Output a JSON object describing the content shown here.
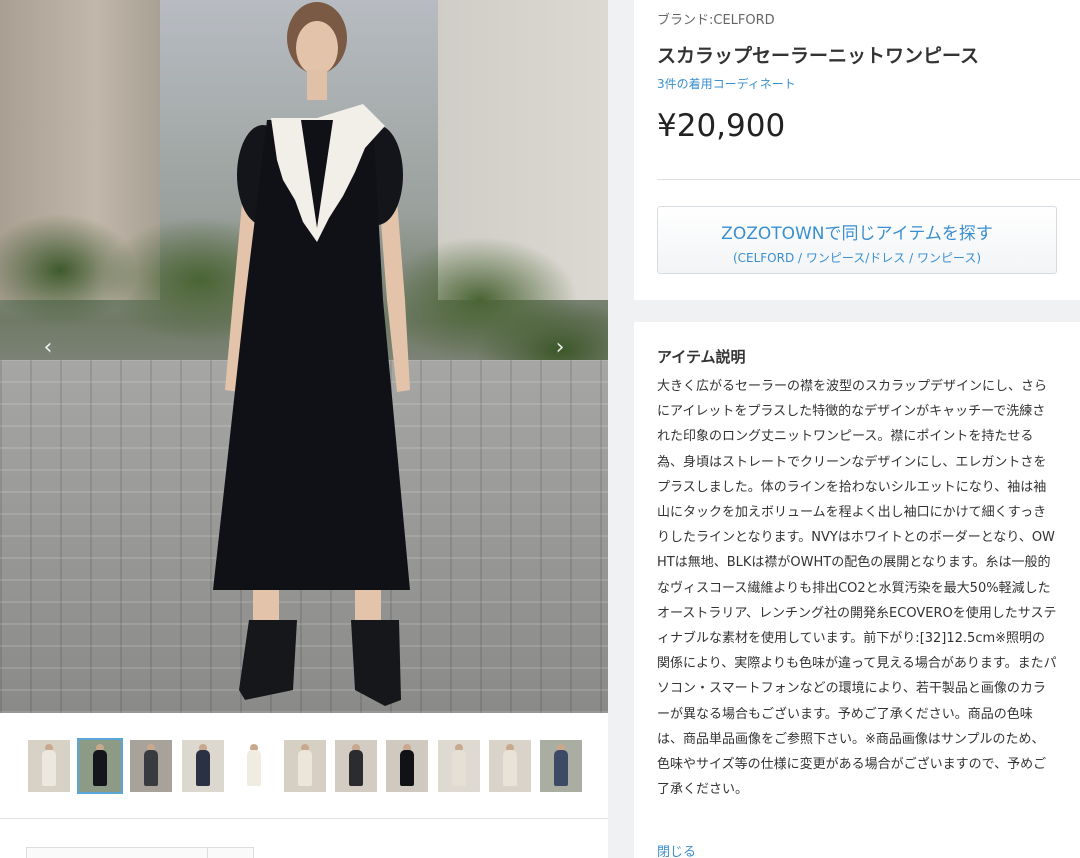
{
  "product": {
    "brand_label": "ブランド:CELFORD",
    "name": "スカラップセーラーニットワンピース",
    "coordinate_link": "3件の着用コーディネート",
    "price": "¥20,900"
  },
  "zozo_button": {
    "main_label": "ZOZOTOWNで同じアイテムを探す",
    "sub_label": "(CELFORD / ワンピース/ドレス / ワンピース)"
  },
  "description": {
    "title": "アイテム説明",
    "body": "大きく広がるセーラーの襟を波型のスカラップデザインにし、さらにアイレットをプラスした特徴的なデザインがキャッチーで洗練された印象のロング丈ニットワンピース。襟にポイントを持たせる為、身頃はストレートでクリーンなデザインにし、エレガントさをプラスしました。体のラインを拾わないシルエットになり、袖は袖山にタックを加えボリュームを程よく出し袖口にかけて細くすっきりしたラインとなります。NVYはホワイトとのボーダーとなり、OWHTは無地、BLKは襟がOWHTの配色の展開となります。糸は一般的なヴィスコース繊維よりも排出CO2と水質汚染を最大50%軽減したオーストラリア、レンチング社の開発糸ECOVEROを使用したサスティナブルな素材を使用しています。前下がり:[32]12.5cm※照明の関係により、実際よりも色味が違って見える場合があります。またパソコン・スマートフォンなどの環境により、若干製品と画像のカラーが異なる場合もございます。予めご了承ください。商品の色味は、商品単品画像をご参照下さい。※商品画像はサンプルのため、色味やサイズ等の仕様に変更がある場合がございますので、予めご了承ください。",
    "close_label": "閉じる"
  },
  "gallery": {
    "prev_icon": "chevron-left-icon",
    "next_icon": "chevron-right-icon",
    "prev_glyph": "‹",
    "next_glyph": "›",
    "thumbnails": [
      {
        "bg": "#d8d2c6",
        "dress": "#ece8df",
        "active": false
      },
      {
        "bg": "#8c9a86",
        "dress": "#15161c",
        "active": true
      },
      {
        "bg": "#a8a39a",
        "dress": "#3a3b40",
        "active": false
      },
      {
        "bg": "#dcd7cf",
        "dress": "#2b3042",
        "active": false
      },
      {
        "bg": "#ffffff",
        "dress": "#f1ece1",
        "active": false
      },
      {
        "bg": "#d6cfc4",
        "dress": "#ece6da",
        "active": false
      },
      {
        "bg": "#d2ccc2",
        "dress": "#2c2c30",
        "active": false
      },
      {
        "bg": "#cfc9bf",
        "dress": "#111216",
        "active": false
      },
      {
        "bg": "#ded9d1",
        "dress": "#e6e0d4",
        "active": false
      },
      {
        "bg": "#d9d3c9",
        "dress": "#e9e3d7",
        "active": false
      },
      {
        "bg": "#a9ada2",
        "dress": "#3d4a66",
        "active": false
      }
    ]
  },
  "colors": {
    "link": "#3a8fd0",
    "active_thumb": "#5aa6d6"
  }
}
